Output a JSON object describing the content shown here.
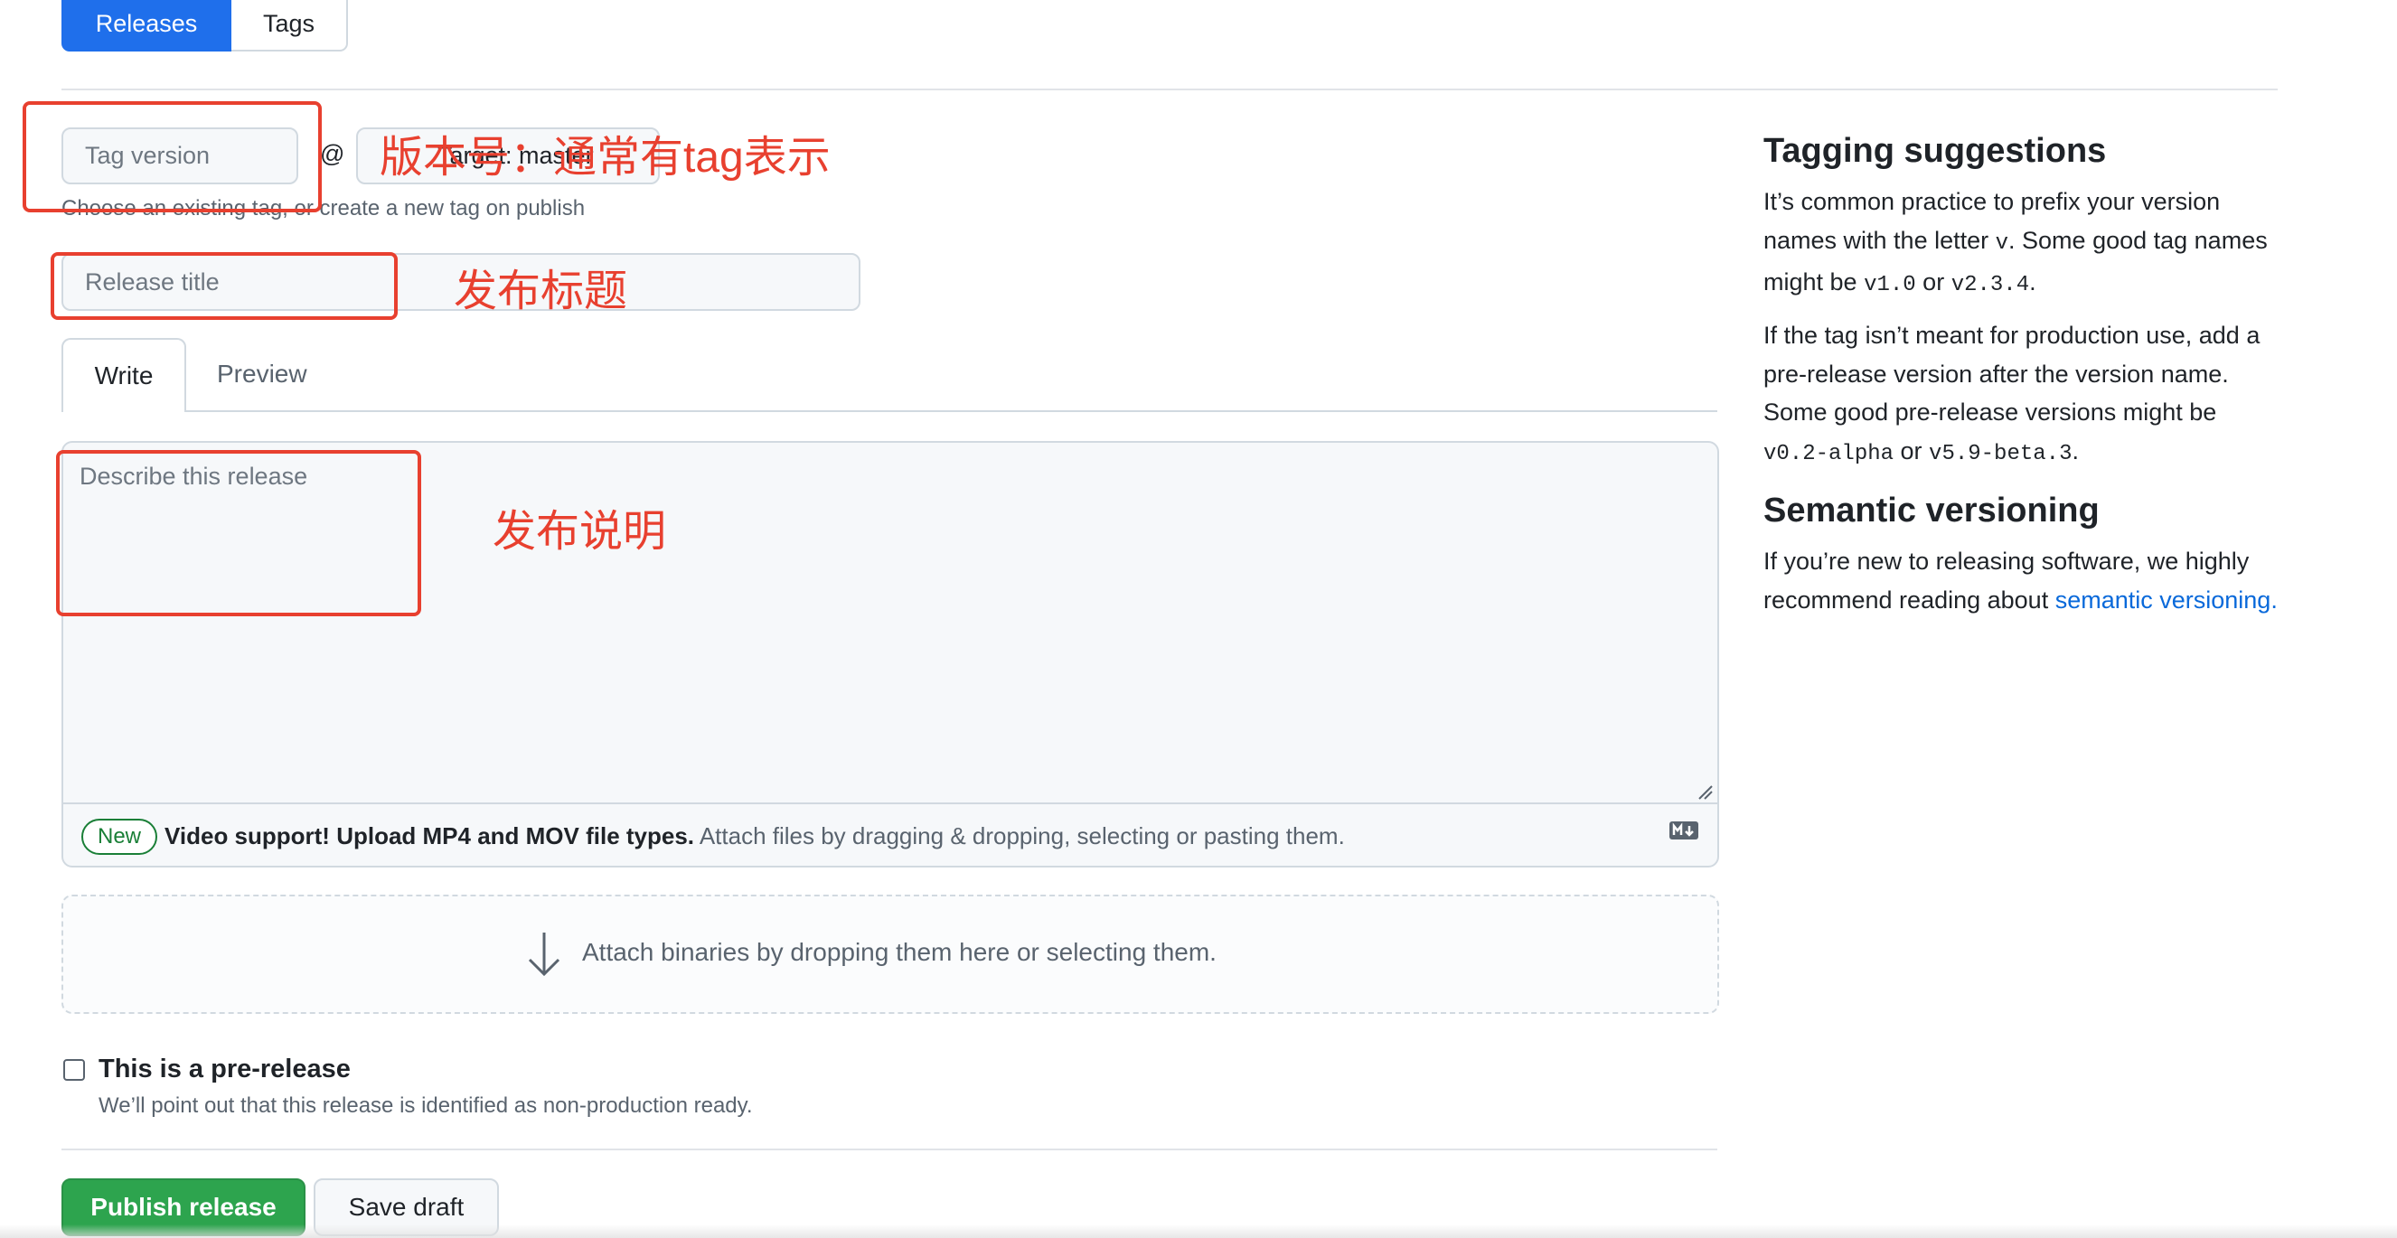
{
  "tabs": {
    "releases": "Releases",
    "tags": "Tags"
  },
  "form": {
    "tag_placeholder": "Tag version",
    "at_symbol": "@",
    "target_label": "Target: master",
    "tag_hint": "Choose an existing tag, or create a new tag on publish",
    "title_placeholder": "Release title",
    "write_tab": "Write",
    "preview_tab": "Preview",
    "description_placeholder": "Describe this release",
    "new_badge": "New",
    "attach_bold": "Video support! Upload MP4 and MOV file types.",
    "attach_rest": " Attach files by dragging & dropping, selecting or pasting them.",
    "drop_text": "Attach binaries by dropping them here or selecting them.",
    "prerelease_label": "This is a pre-release",
    "prerelease_note": "We’ll point out that this release is identified as non-production ready.",
    "publish_button": "Publish release",
    "draft_button": "Save draft"
  },
  "sidebar": {
    "tagging_heading": "Tagging suggestions",
    "tagging_p1_a": "It’s common practice to prefix your version names with the letter ",
    "tagging_p1_code1": "v",
    "tagging_p1_b": ". Some good tag names might be ",
    "tagging_p1_code2": "v1.0",
    "tagging_p1_c": " or ",
    "tagging_p1_code3": "v2.3.4",
    "tagging_p1_d": ".",
    "tagging_p2_a": "If the tag isn’t meant for production use, add a pre-release version after the version name. Some good pre-release versions might be ",
    "tagging_p2_code1": "v0.2-alpha",
    "tagging_p2_b": " or ",
    "tagging_p2_code2": "v5.9-beta.3",
    "tagging_p2_c": ".",
    "semver_heading": "Semantic versioning",
    "semver_p_a": "If you’re new to releasing software, we highly recommend reading about ",
    "semver_link": "semantic versioning",
    "semver_p_b": "."
  },
  "annotations": {
    "version": "版本号：通常有tag表示",
    "title": "发布标题",
    "description": "发布说明"
  },
  "colors": {
    "accent_blue": "#1f6feb",
    "publish_green": "#2da44e",
    "annotation_red": "#e8402f",
    "link_blue": "#0969da"
  },
  "icons": [
    "tag-icon",
    "arrow-down-icon",
    "markdown-icon",
    "resize-handle-icon"
  ]
}
